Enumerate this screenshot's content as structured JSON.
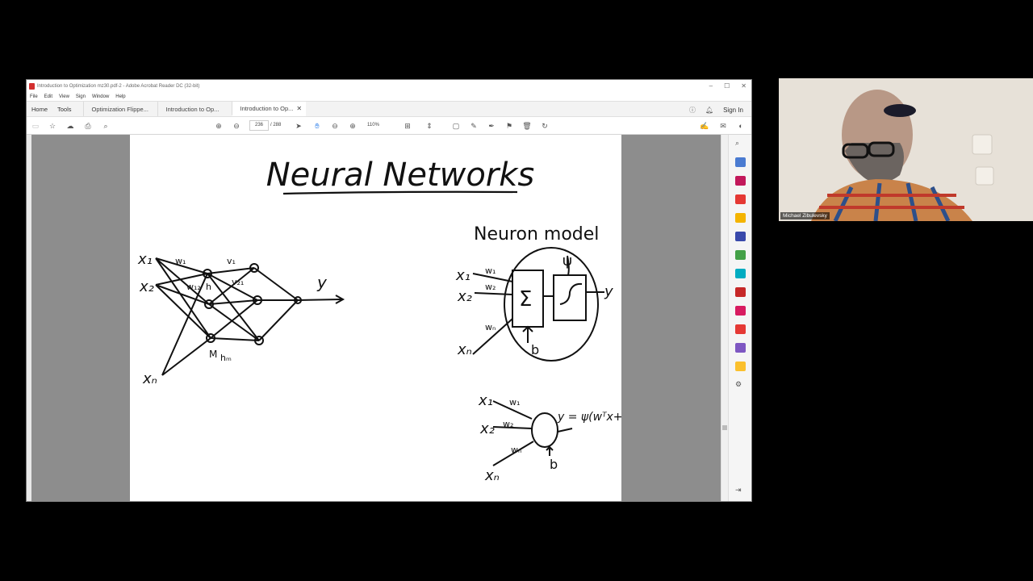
{
  "window": {
    "title": "Introduction to Optimization mz30.pdf-2 - Adobe Acrobat Reader DC (32-bit)",
    "controls": [
      "–",
      "☐",
      "✕"
    ]
  },
  "menu": [
    "File",
    "Edit",
    "View",
    "Sign",
    "Window",
    "Help"
  ],
  "tabs": {
    "home": "Home",
    "tools": "Tools",
    "docs": [
      "Optimization Flippe...",
      "Introduction to Op...",
      "Introduction to Op..."
    ],
    "active_index": 2,
    "close": "✕",
    "sign_in": "Sign In"
  },
  "toolbar": {
    "page_current": "236",
    "page_total": "/ 288",
    "zoom": "110%"
  },
  "slide": {
    "title": "Neural Networks",
    "neuron_model_label": "Neuron model",
    "net_inputs": [
      "x₁",
      "x₂",
      "xₙ"
    ],
    "net_weights": [
      "w₁",
      "w₁₂",
      "v₁",
      "v₂₁"
    ],
    "net_hidden_labels": [
      "h",
      "M",
      "hₘ"
    ],
    "net_output": "y",
    "model_inputs": [
      "x₁",
      "x₂",
      "xₙ"
    ],
    "model_weights": [
      "w₁",
      "w₂",
      "wₙ"
    ],
    "sum_symbol": "Σ",
    "activation_symbol": "ψ",
    "bias": "b",
    "model_output": "y",
    "bottom_inputs": [
      "x₁",
      "x₂",
      "xₙ"
    ],
    "bottom_weights": [
      "w₁",
      "w₂",
      "wₙ"
    ],
    "bottom_bias": "b",
    "formula": "y = ψ(wᵀx+b)"
  },
  "webcam": {
    "name": "Michael Zibulevsky"
  },
  "colors": {
    "accent_pdf": "#d32f2f",
    "doc_bg": "#8d8d8d",
    "ink": "#111111"
  }
}
